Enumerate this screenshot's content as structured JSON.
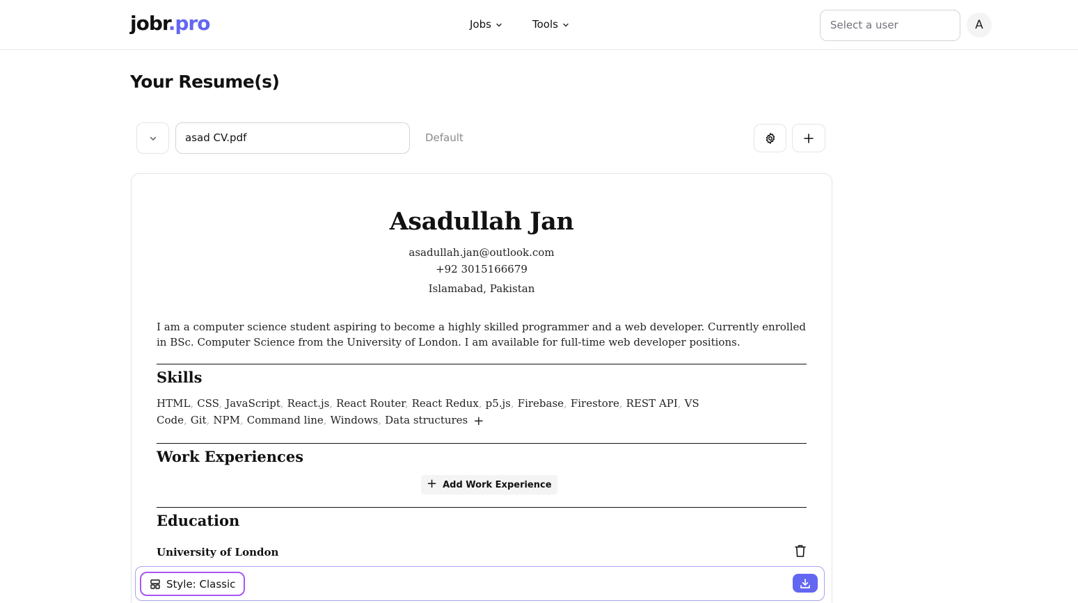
{
  "header": {
    "logo_main": "jobr",
    "logo_accent": ".pro",
    "nav": [
      {
        "label": "Jobs"
      },
      {
        "label": "Tools"
      }
    ],
    "user_select_placeholder": "Select a user",
    "avatar_initial": "A"
  },
  "page": {
    "title": "Your Resume(s)"
  },
  "toolbar": {
    "resume_filename": "asad CV.pdf",
    "default_label": "Default"
  },
  "resume": {
    "name": "Asadullah Jan",
    "email": "asadullah.jan@outlook.com",
    "phone": "+92 3015166679",
    "location": "Islamabad, Pakistan",
    "summary": "I am a computer science student aspiring to become a highly skilled programmer and a web developer. Currently enrolled in BSc. Computer Science from the University of London. I am available for full-time web developer positions.",
    "skills_title": "Skills",
    "skills": [
      "HTML",
      "CSS",
      "JavaScript",
      "React.js",
      "React Router",
      "React Redux",
      "p5.js",
      "Firebase",
      "Firestore",
      "REST API",
      "VS Code",
      "Git",
      "NPM",
      "Command line",
      "Windows",
      "Data structures"
    ],
    "work_title": "Work Experiences",
    "add_work_label": "Add Work Experience",
    "education_title": "Education",
    "education": [
      {
        "school": "University of London"
      }
    ]
  },
  "bottom_bar": {
    "style_label": "Style: Classic"
  },
  "colors": {
    "accent": "#6366f1",
    "style_border": "#a855f7"
  }
}
